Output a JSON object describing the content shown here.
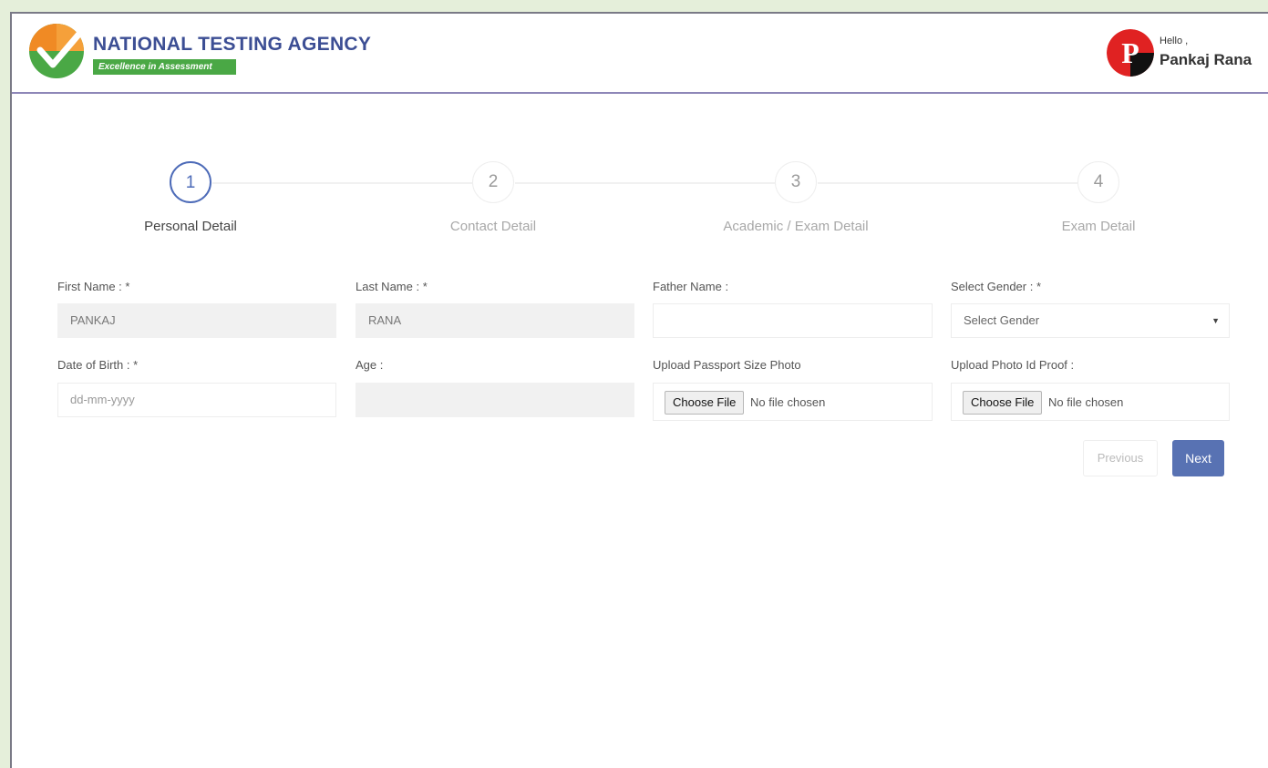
{
  "header": {
    "brand_name": "NATIONAL TESTING AGENCY",
    "brand_tagline": "Excellence in Assessment",
    "greeting": "Hello ,",
    "user_name": "Pankaj Rana",
    "avatar_letter": "P"
  },
  "steps": [
    {
      "number": "1",
      "label": "Personal Detail",
      "state": "active"
    },
    {
      "number": "2",
      "label": "Contact Detail",
      "state": "inactive"
    },
    {
      "number": "3",
      "label": "Academic / Exam Detail",
      "state": "inactive"
    },
    {
      "number": "4",
      "label": "Exam Detail",
      "state": "inactive"
    }
  ],
  "form": {
    "first_name_label": "First Name : *",
    "first_name_value": "PANKAJ",
    "last_name_label": "Last Name : *",
    "last_name_value": "RANA",
    "father_name_label": "Father Name :",
    "father_name_value": "",
    "gender_label": "Select Gender : *",
    "gender_selected": "Select Gender",
    "dob_label": "Date of Birth : *",
    "dob_placeholder": "dd-mm-yyyy",
    "age_label": "Age :",
    "age_value": "",
    "photo_label": "Upload Passport Size Photo",
    "photo_button": "Choose File",
    "photo_status": "No file chosen",
    "id_proof_label": "Upload Photo Id Proof :",
    "id_proof_button": "Choose File",
    "id_proof_status": "No file chosen"
  },
  "buttons": {
    "previous": "Previous",
    "next": "Next"
  },
  "colors": {
    "brand_blue": "#3c4e94",
    "brand_green": "#4aa845",
    "accent_blue": "#5872b3",
    "avatar_red": "#e02222"
  }
}
